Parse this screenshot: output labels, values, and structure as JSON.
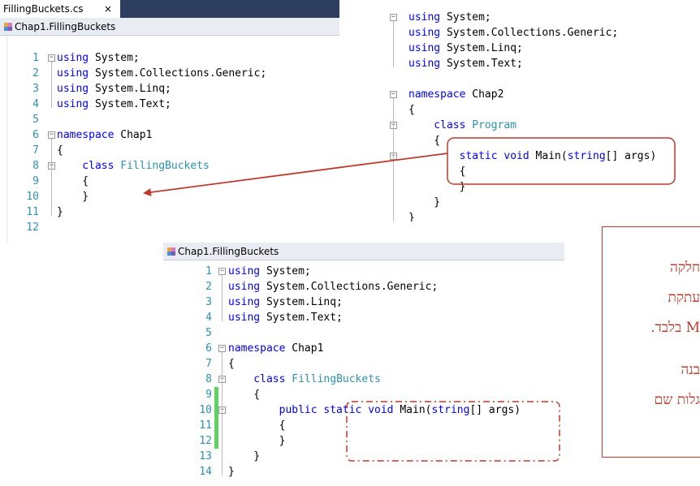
{
  "panel1": {
    "tab_title": "FillingBuckets.cs",
    "tab_close": "×",
    "nav_label": "Chap1.FillingBuckets",
    "lines": [
      {
        "n": "1",
        "parts": [
          {
            "t": "using",
            "c": "kw"
          },
          {
            "t": " System;",
            "c": "tx"
          }
        ]
      },
      {
        "n": "2",
        "parts": [
          {
            "t": "using",
            "c": "kw"
          },
          {
            "t": " System.Collections.Generic;",
            "c": "tx"
          }
        ]
      },
      {
        "n": "3",
        "parts": [
          {
            "t": "using",
            "c": "kw"
          },
          {
            "t": " System.Linq;",
            "c": "tx"
          }
        ]
      },
      {
        "n": "4",
        "parts": [
          {
            "t": "using",
            "c": "kw"
          },
          {
            "t": " System.Text;",
            "c": "tx"
          }
        ]
      },
      {
        "n": "5",
        "parts": []
      },
      {
        "n": "6",
        "parts": [
          {
            "t": "namespace",
            "c": "kw"
          },
          {
            "t": " Chap1",
            "c": "tx"
          }
        ]
      },
      {
        "n": "7",
        "parts": [
          {
            "t": "{",
            "c": "tx"
          }
        ]
      },
      {
        "n": "8",
        "parts": [
          {
            "t": "    class",
            "c": "kw"
          },
          {
            "t": " FillingBuckets",
            "c": "ty"
          }
        ]
      },
      {
        "n": "9",
        "parts": [
          {
            "t": "    {",
            "c": "tx"
          }
        ]
      },
      {
        "n": "10",
        "parts": [
          {
            "t": "    }",
            "c": "tx"
          }
        ]
      },
      {
        "n": "11",
        "parts": [
          {
            "t": "}",
            "c": "tx"
          }
        ]
      },
      {
        "n": "12",
        "parts": []
      }
    ]
  },
  "panel2": {
    "lines": [
      {
        "parts": [
          {
            "t": "using",
            "c": "kw"
          },
          {
            "t": " System;",
            "c": "tx"
          }
        ]
      },
      {
        "parts": [
          {
            "t": "using",
            "c": "kw"
          },
          {
            "t": " System.Collections.Generic;",
            "c": "tx"
          }
        ]
      },
      {
        "parts": [
          {
            "t": "using",
            "c": "kw"
          },
          {
            "t": " System.Linq;",
            "c": "tx"
          }
        ]
      },
      {
        "parts": [
          {
            "t": "using",
            "c": "kw"
          },
          {
            "t": " System.Text;",
            "c": "tx"
          }
        ]
      },
      {
        "parts": []
      },
      {
        "parts": [
          {
            "t": "namespace",
            "c": "kw"
          },
          {
            "t": " Chap2",
            "c": "tx"
          }
        ]
      },
      {
        "parts": [
          {
            "t": "{",
            "c": "tx"
          }
        ]
      },
      {
        "parts": [
          {
            "t": "    class",
            "c": "kw"
          },
          {
            "t": " Program",
            "c": "ty"
          }
        ]
      },
      {
        "parts": [
          {
            "t": "    {",
            "c": "tx"
          }
        ]
      },
      {
        "parts": [
          {
            "t": "        static",
            "c": "kw"
          },
          {
            "t": " ",
            "c": "tx"
          },
          {
            "t": "void",
            "c": "kw"
          },
          {
            "t": " Main(",
            "c": "tx"
          },
          {
            "t": "string",
            "c": "kw"
          },
          {
            "t": "[] args)",
            "c": "tx"
          }
        ]
      },
      {
        "parts": [
          {
            "t": "        {",
            "c": "tx"
          }
        ]
      },
      {
        "parts": [
          {
            "t": "        }",
            "c": "tx"
          }
        ]
      },
      {
        "parts": [
          {
            "t": "    }",
            "c": "tx"
          }
        ]
      },
      {
        "parts": [
          {
            "t": "}",
            "c": "tx"
          }
        ]
      }
    ]
  },
  "panel3": {
    "nav_label": "Chap1.FillingBuckets",
    "lines": [
      {
        "n": "1",
        "parts": [
          {
            "t": "using",
            "c": "kw"
          },
          {
            "t": " System;",
            "c": "tx"
          }
        ]
      },
      {
        "n": "2",
        "parts": [
          {
            "t": "using",
            "c": "kw"
          },
          {
            "t": " System.Collections.Generic;",
            "c": "tx"
          }
        ]
      },
      {
        "n": "3",
        "parts": [
          {
            "t": "using",
            "c": "kw"
          },
          {
            "t": " System.Linq;",
            "c": "tx"
          }
        ]
      },
      {
        "n": "4",
        "parts": [
          {
            "t": "using",
            "c": "kw"
          },
          {
            "t": " System.Text;",
            "c": "tx"
          }
        ]
      },
      {
        "n": "5",
        "parts": []
      },
      {
        "n": "6",
        "parts": [
          {
            "t": "namespace",
            "c": "kw"
          },
          {
            "t": " Chap1",
            "c": "tx"
          }
        ]
      },
      {
        "n": "7",
        "parts": [
          {
            "t": "{",
            "c": "tx"
          }
        ]
      },
      {
        "n": "8",
        "parts": [
          {
            "t": "    class",
            "c": "kw"
          },
          {
            "t": " FillingBuckets",
            "c": "ty"
          }
        ]
      },
      {
        "n": "9",
        "parts": [
          {
            "t": "    {",
            "c": "tx"
          }
        ]
      },
      {
        "n": "10",
        "parts": [
          {
            "t": "        public",
            "c": "kw"
          },
          {
            "t": " ",
            "c": "tx"
          },
          {
            "t": "static",
            "c": "kw"
          },
          {
            "t": " ",
            "c": "tx"
          },
          {
            "t": "void",
            "c": "kw"
          },
          {
            "t": " Main(",
            "c": "tx"
          },
          {
            "t": "string",
            "c": "kw"
          },
          {
            "t": "[] args)",
            "c": "tx"
          }
        ]
      },
      {
        "n": "11",
        "parts": [
          {
            "t": "        {",
            "c": "tx"
          }
        ]
      },
      {
        "n": "12",
        "parts": [
          {
            "t": "        }",
            "c": "tx"
          }
        ]
      },
      {
        "n": "13",
        "parts": [
          {
            "t": "    }",
            "c": "tx"
          }
        ]
      },
      {
        "n": "14",
        "parts": [
          {
            "t": "}",
            "c": "tx"
          }
        ]
      }
    ]
  },
  "note": {
    "lines": [
      "חלקה",
      "עתקת",
      "M בלבד.",
      "בנה",
      "גלות שם"
    ]
  },
  "colors": {
    "accent_red": "#c0392b",
    "keyword": "#0000ff",
    "type": "#2b91af",
    "change_bar": "#5fd35f",
    "tab_strip": "#2d3e61"
  }
}
